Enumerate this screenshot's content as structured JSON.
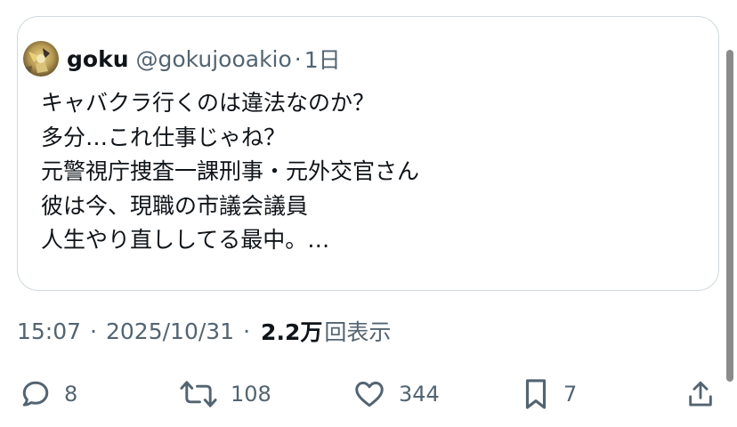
{
  "quoted_post": {
    "author_name": "goku",
    "author_handle": "@gokujooakio",
    "separator": "·",
    "time": "1日",
    "lines": [
      "キャバクラ行くのは違法なのか？",
      "多分…これ仕事じゃね？",
      "元警視庁捜査一課刑事・元外交官さん",
      "彼は今、現職の市議会議員",
      "人生やり直ししてる最中。…"
    ]
  },
  "meta": {
    "time": "15:07",
    "separator": "·",
    "date": "2025/10/31",
    "views_count": "2.2万",
    "views_label": "回表示"
  },
  "actions": {
    "replies": "8",
    "reposts": "108",
    "likes": "344",
    "bookmarks": "7"
  },
  "icons": {
    "reply": "reply-icon",
    "repost": "repost-icon",
    "like": "heart-icon",
    "bookmark": "bookmark-icon",
    "share": "share-icon"
  },
  "colors": {
    "text_primary": "#0f1419",
    "text_secondary": "#536471",
    "border": "#cfd9de",
    "icon": "#536471",
    "scrollbar": "#8b8b8b"
  }
}
